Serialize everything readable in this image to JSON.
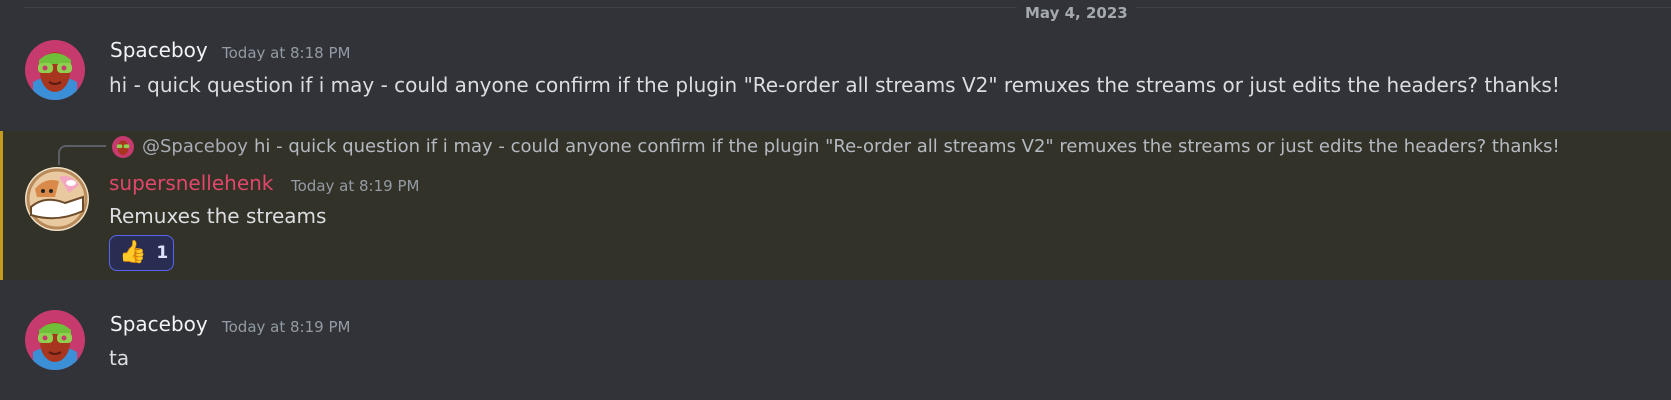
{
  "date_divider": "May 4, 2023",
  "messages": [
    {
      "author": "Spaceboy",
      "timestamp": "Today at 8:18 PM",
      "text": "hi - quick question if i may - could anyone confirm if the plugin \"Re-order all streams V2\" remuxes the streams or just edits the headers? thanks!"
    },
    {
      "author": "supersnellehenk",
      "timestamp": "Today at 8:19 PM",
      "text": "Remuxes the streams",
      "reply": {
        "mention": "@Spaceboy",
        "text": "hi - quick question if i may - could anyone confirm if the plugin \"Re-order all streams V2\" remuxes the streams or just edits the headers? thanks!"
      },
      "reaction": {
        "emoji": "👍",
        "icon": "thumbs-up-icon",
        "count": "1"
      }
    },
    {
      "author": "Spaceboy",
      "timestamp": "Today at 8:19 PM",
      "text": "ta"
    }
  ],
  "colors": {
    "background": "#313338",
    "highlight_bg": "#333229",
    "highlight_border": "#c49b1e",
    "username_pink": "#e0466e",
    "reaction_border": "#5865f2"
  }
}
